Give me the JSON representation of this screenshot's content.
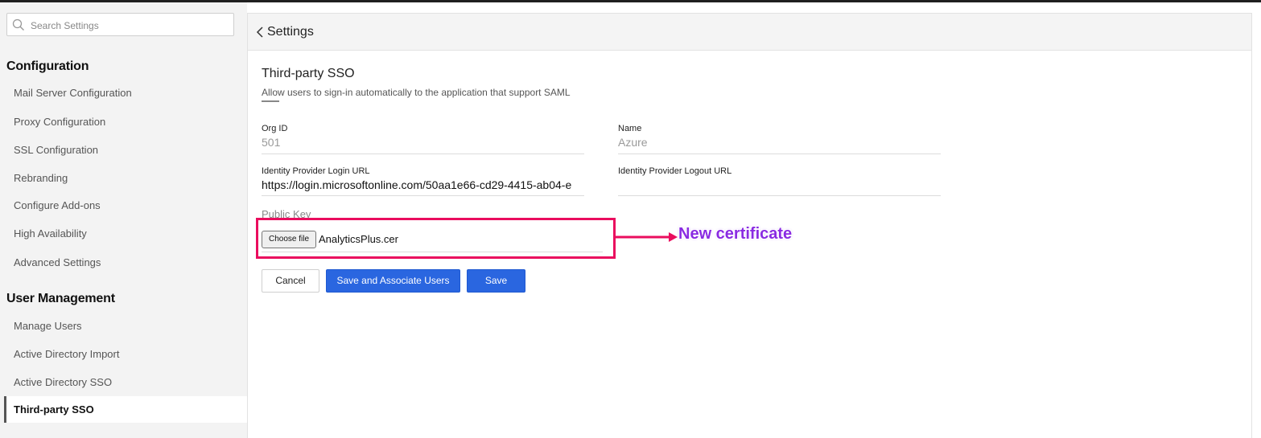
{
  "search": {
    "placeholder": "Search Settings"
  },
  "sidebar": {
    "sections": [
      {
        "title": "Configuration",
        "items": [
          "Mail Server Configuration",
          "Proxy Configuration",
          "SSL Configuration",
          "Rebranding",
          "Configure Add-ons",
          "High Availability",
          "Advanced Settings"
        ]
      },
      {
        "title": "User Management",
        "items": [
          "Manage Users",
          "Active Directory Import",
          "Active Directory SSO",
          "Third-party SSO"
        ]
      }
    ],
    "active_item": "Third-party SSO"
  },
  "header": {
    "back_icon": "chevron-left-icon",
    "title": "Settings"
  },
  "page": {
    "title": "Third-party SSO",
    "subtitle": "Allow users to sign-in automatically to the application that support SAML"
  },
  "form": {
    "org_id": {
      "label": "Org ID",
      "value": "501"
    },
    "name": {
      "label": "Name",
      "value": "Azure"
    },
    "login_url": {
      "label": "Identity Provider Login URL",
      "value": "https://login.microsoftonline.com/50aa1e66-cd29-4415-ab04-e"
    },
    "logout_url": {
      "label": "Identity Provider Logout URL",
      "value": ""
    },
    "public_key": {
      "label": "Public Key",
      "button": "Choose file",
      "file_name": "AnalyticsPlus.cer"
    }
  },
  "buttons": {
    "cancel": "Cancel",
    "save_associate": "Save and Associate Users",
    "save": "Save"
  },
  "annotation": {
    "text": "New certificate",
    "highlight_color": "#ea0d5e",
    "text_color": "#8a2be2"
  },
  "colors": {
    "primary": "#2a66e0",
    "sidebar_bg": "#f3f3f3"
  }
}
